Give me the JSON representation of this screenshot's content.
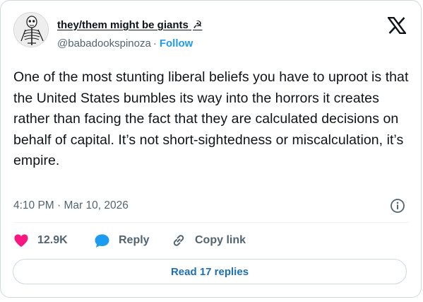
{
  "author": {
    "display_name": "they/them might be giants",
    "emoji": "☭",
    "handle": "@babadookspinoza",
    "separator": "·",
    "follow_label": "Follow"
  },
  "tweet": {
    "text": "One of the most stunting liberal beliefs you have to uproot is that the United States bumbles its way into the horrors it creates rather than facing the fact that they are calculated decisions on behalf of capital. It’s not short-sightedness or miscalculation, it’s empire.",
    "timestamp": "4:10 PM · Mar 10, 2026"
  },
  "actions": {
    "likes_count": "12.9K",
    "reply_label": "Reply",
    "copy_label": "Copy link"
  },
  "footer": {
    "read_replies_label": "Read 17 replies"
  },
  "icons": {
    "brand": "x-logo-icon",
    "info": "info-icon",
    "like": "heart-icon",
    "reply": "speech-bubble-icon",
    "copy": "link-icon"
  },
  "colors": {
    "heart": "#f91880",
    "reply_bubble": "#1d9bf0",
    "follow": "#1d9bf0",
    "read_replies": "#1d6fb8"
  }
}
